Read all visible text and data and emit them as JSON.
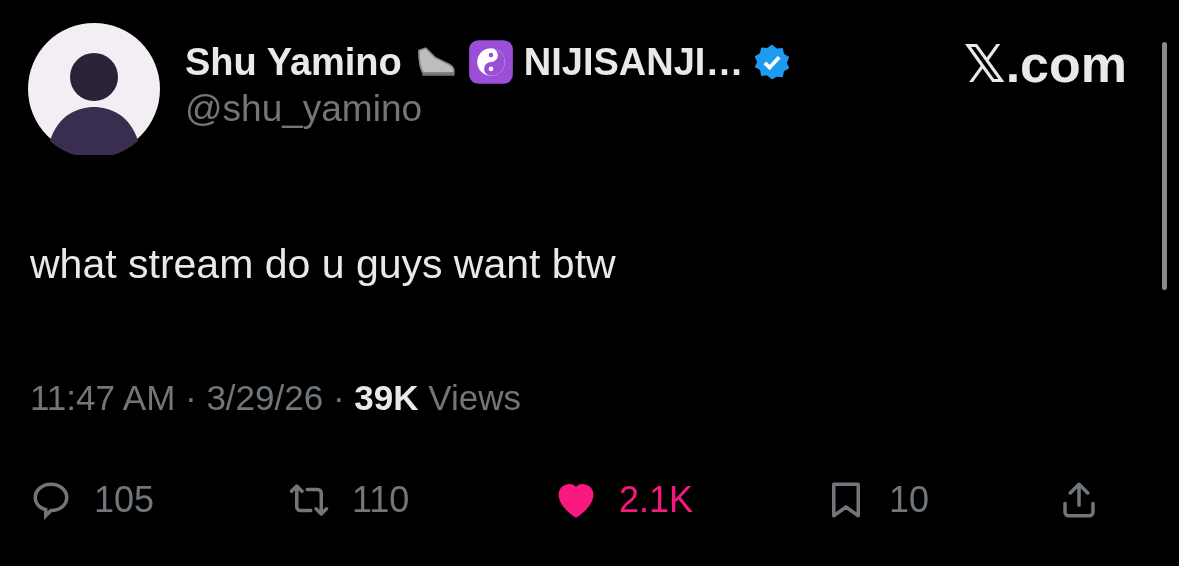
{
  "author": {
    "name": "Shu Yamino",
    "display_suffix": "NIJISANJI…",
    "verified": true,
    "handle": "@shu_yamino"
  },
  "site": "𝕏.com",
  "text": "what stream do u guys want btw",
  "meta": "11:47 AM · 3/29/26 · **39K** Views",
  "actions": [
    {
      "kind": "reply",
      "count": "105",
      "active": false
    },
    {
      "kind": "repost",
      "count": "110",
      "active": false
    },
    {
      "kind": "like",
      "count": "2.1K",
      "active": true
    },
    {
      "kind": "bookmark",
      "count": "10",
      "active": false
    },
    {
      "kind": "share",
      "active": false
    }
  ]
}
